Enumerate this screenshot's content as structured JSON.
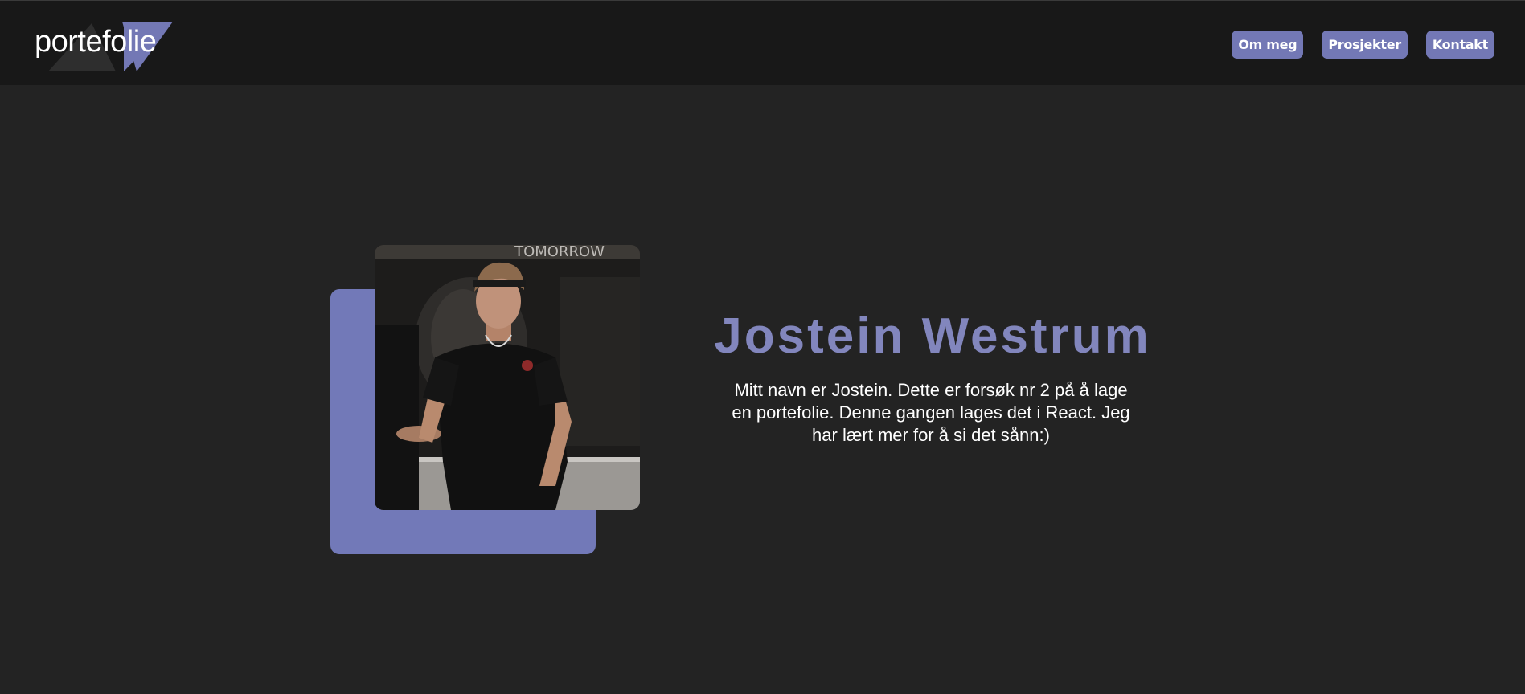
{
  "header": {
    "logo_text": "portefolie",
    "nav": [
      {
        "label": "Om meg"
      },
      {
        "label": "Prosjekter"
      },
      {
        "label": "Kontakt"
      }
    ]
  },
  "hero": {
    "photo_sign_text": "TOMORROW",
    "name": "Jostein Westrum",
    "description": "Mitt navn er Jostein. Dette er forsøk nr 2 på å lage en portefolie. Denne gangen lages det i React. Jeg har lært mer for å si det sånn:)"
  },
  "colors": {
    "accent": "#7378b5",
    "name_color": "#8286bd",
    "background": "#232323",
    "header_bg": "#181818"
  }
}
